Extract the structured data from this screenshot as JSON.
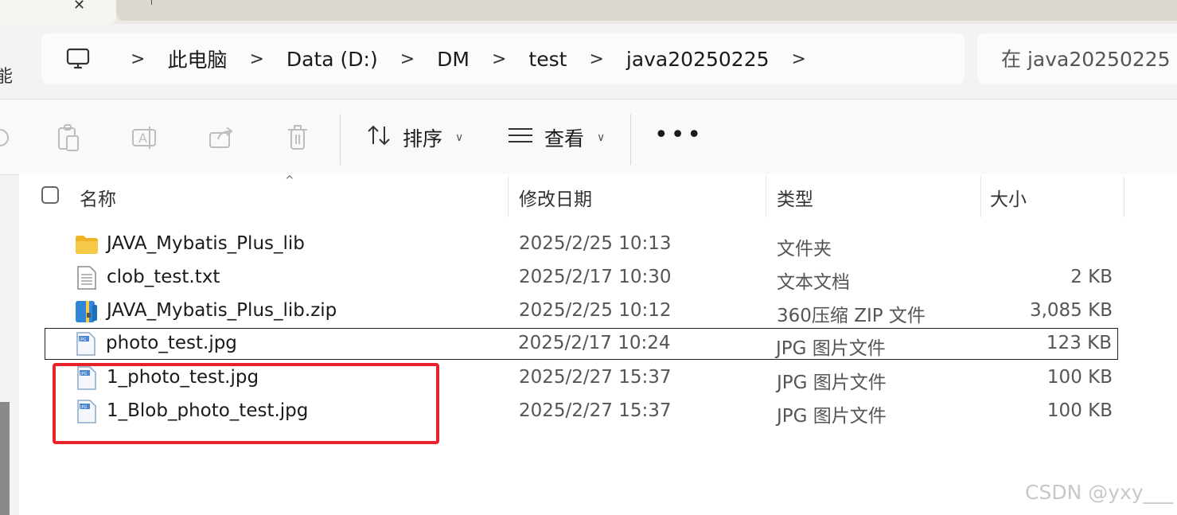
{
  "window": {
    "close_glyph": "✕"
  },
  "left_fragment": "能",
  "breadcrumb": {
    "items": [
      "此电脑",
      "Data (D:)",
      "DM",
      "test",
      "java20250225"
    ],
    "separator": ">"
  },
  "search": {
    "placeholder": "在 java20250225 中"
  },
  "toolbar": {
    "sort_label": "排序",
    "view_label": "查看",
    "more_label": "•••"
  },
  "columns": {
    "name": "名称",
    "modified": "修改日期",
    "type": "类型",
    "size": "大小"
  },
  "files": [
    {
      "name": "JAVA_Mybatis_Plus_lib",
      "modified": "2025/2/25 10:13",
      "type": "文件夹",
      "size": "",
      "icon": "folder-icon"
    },
    {
      "name": "clob_test.txt",
      "modified": "2025/2/17 10:30",
      "type": "文本文档",
      "size": "2 KB",
      "icon": "text-file-icon"
    },
    {
      "name": "JAVA_Mybatis_Plus_lib.zip",
      "modified": "2025/2/25 10:12",
      "type": "360压缩 ZIP 文件",
      "size": "3,085 KB",
      "icon": "zip-file-icon"
    },
    {
      "name": "photo_test.jpg",
      "modified": "2025/2/17 10:24",
      "type": "JPG 图片文件",
      "size": "123 KB",
      "icon": "jpg-file-icon"
    },
    {
      "name": "1_photo_test.jpg",
      "modified": "2025/2/27 15:37",
      "type": "JPG 图片文件",
      "size": "100 KB",
      "icon": "jpg-file-icon"
    },
    {
      "name": "1_Blob_photo_test.jpg",
      "modified": "2025/2/27 15:37",
      "type": "JPG 图片文件",
      "size": "100 KB",
      "icon": "jpg-file-icon"
    }
  ],
  "jpg_badge": "JPG",
  "watermark": "CSDN @yxy___",
  "colors": {
    "highlight_box": "#e8222a",
    "folder": "#f7c948",
    "zip_blue": "#2f86d6"
  }
}
